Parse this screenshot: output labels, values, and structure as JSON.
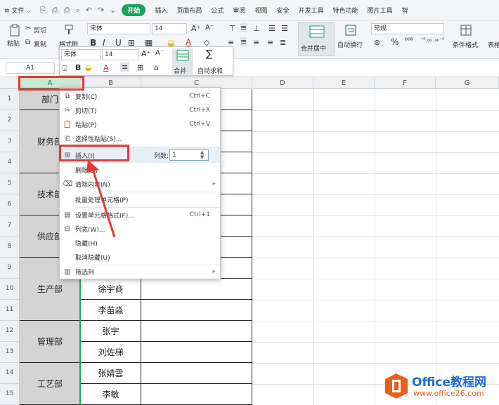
{
  "menubar": {
    "file": "≡ 文件 ⌵",
    "quick_icons": [
      "⎘",
      "⎙",
      "⎙",
      "⌕",
      "↶",
      "↷",
      "⌄"
    ],
    "tabs": [
      "开始",
      "插入",
      "页面布局",
      "公式",
      "审阅",
      "视图",
      "安全",
      "开发工具",
      "特色功能",
      "图片工具",
      "智"
    ]
  },
  "ribbon": {
    "paste": "粘贴",
    "cut": "剪切",
    "copy": "复制",
    "format_painter": "格式刷",
    "font": "宋体",
    "size": "14",
    "bold": "B",
    "italic": "I",
    "underline": "U",
    "merge": "合并居中",
    "wrap": "自动换行",
    "number_format": "常规",
    "cond_format": "条件格式",
    "table_style": "表格"
  },
  "formula": {
    "namebox": "A1"
  },
  "columns": [
    "A",
    "B",
    "C",
    "D",
    "E",
    "F",
    "G"
  ],
  "rows": [
    "1",
    "2",
    "3",
    "4",
    "5",
    "6",
    "7",
    "8",
    "9",
    "10",
    "11",
    "12",
    "13",
    "14",
    "15"
  ],
  "cells": {
    "a1": "部门",
    "dept1": "财务部",
    "dept2": "技术部",
    "dept3": "供应部",
    "dept4": "生产部",
    "dept5": "管理部",
    "dept6": "工艺部",
    "b10": "徐宇商",
    "b11": "李苗淼",
    "b12": "张宇",
    "b13": "刘佐梯",
    "b14": "张婧雲",
    "b15": "李敏"
  },
  "mini_toolbar": {
    "font": "宋体",
    "size": "14",
    "merge": "合并",
    "autosum": "自动求和"
  },
  "context_menu": {
    "copy": "复制(C)",
    "copy_sc": "Ctrl+C",
    "cut": "剪切(T)",
    "cut_sc": "Ctrl+X",
    "paste": "粘贴(P)",
    "paste_sc": "Ctrl+V",
    "paste_special": "选择性粘贴(S)...",
    "insert": "插入(I)",
    "insert_count_label": "列数:",
    "insert_count": "1",
    "delete": "删除(D)",
    "clear": "清除内容(N)",
    "batch": "批量处理单元格(P)",
    "format": "设置单元格格式(F)...",
    "format_sc": "Ctrl+1",
    "width": "列宽(W)...",
    "hide": "隐藏(H)",
    "unhide": "取消隐藏(U)",
    "filter": "筛选列"
  },
  "watermark": {
    "brand": "Office教程网",
    "url": "www.office26.com"
  },
  "colors": {
    "accent": "#1aa260",
    "highlight": "#e53935",
    "logo_orange": "#e8601c",
    "logo_blue": "#1f6fd1"
  }
}
